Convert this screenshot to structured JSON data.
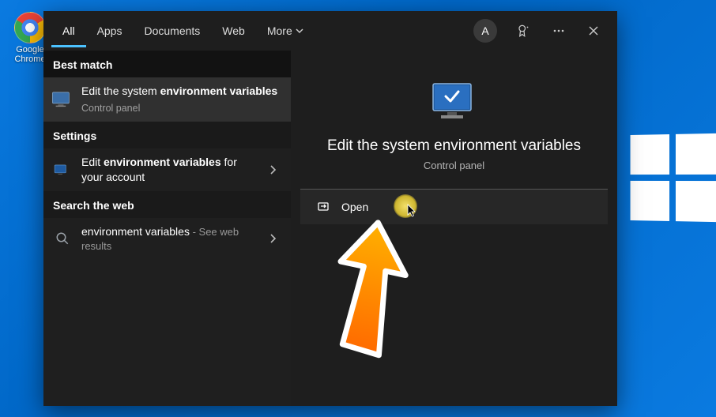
{
  "desktop": {
    "chrome_label": "Google Chrome"
  },
  "tabs": {
    "all": "All",
    "apps": "Apps",
    "documents": "Documents",
    "web": "Web",
    "more": "More"
  },
  "header": {
    "avatar_letter": "A"
  },
  "sections": {
    "best_match": "Best match",
    "settings": "Settings",
    "search_web": "Search the web"
  },
  "results": {
    "best": {
      "title_pre": "Edit the system ",
      "title_bold": "environment variables",
      "subtitle": "Control panel"
    },
    "settings_item": {
      "title_pre": "Edit ",
      "title_bold": "environment variables",
      "title_post": " for your account"
    },
    "web_item": {
      "term": "environment variables",
      "suffix": " - See web results"
    }
  },
  "preview": {
    "title": "Edit the system environment variables",
    "subtitle": "Control panel"
  },
  "actions": {
    "open": "Open"
  }
}
